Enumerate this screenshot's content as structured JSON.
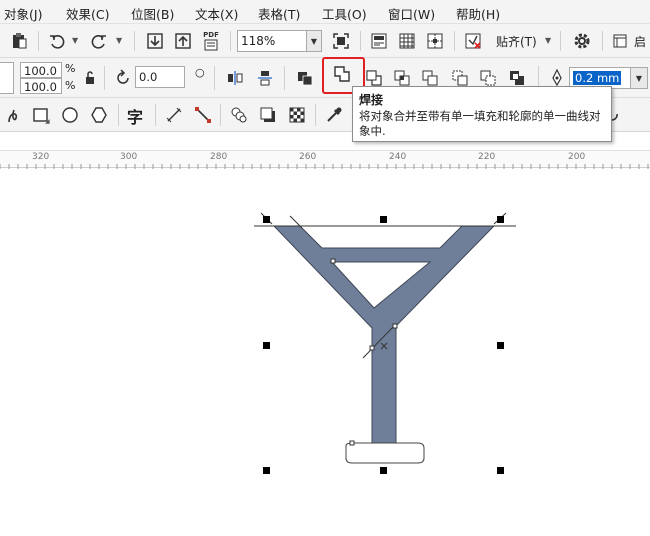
{
  "menu": {
    "items": [
      {
        "label": "对象(J)"
      },
      {
        "label": "效果(C)"
      },
      {
        "label": "位图(B)"
      },
      {
        "label": "文本(X)"
      },
      {
        "label": "表格(T)"
      },
      {
        "label": "工具(O)"
      },
      {
        "label": "窗口(W)"
      },
      {
        "label": "帮助(H)"
      }
    ]
  },
  "toolbar1": {
    "pdf_label": "PDF",
    "zoom_value": "118%",
    "snap_label": "贴齐(T)",
    "launch_label": "启"
  },
  "toolbar2": {
    "scale_x": "100.0",
    "scale_y": "100.0",
    "percent_x": "%",
    "percent_y": "%",
    "rotation": "0.0",
    "outline_width": "0.2 mm"
  },
  "toolbox": {
    "text_tool_glyph": "字"
  },
  "tooltip": {
    "title": "焊接",
    "description": "将对象合并至带有单一填充和轮廓的单一曲线对象中."
  },
  "ruler": {
    "labels": [
      "320",
      "300",
      "280",
      "260",
      "240",
      "220",
      "200"
    ]
  },
  "colors": {
    "shape_fill": "#6f7f9a",
    "highlight": "#e02020",
    "selected_outline_field": "#0a64c8"
  }
}
